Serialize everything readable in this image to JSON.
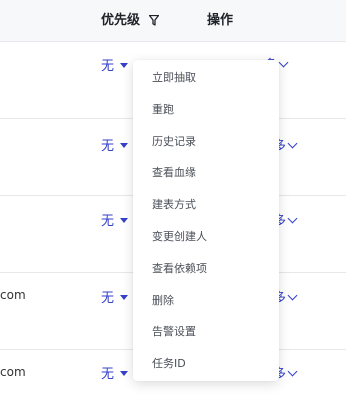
{
  "table": {
    "header": {
      "priority_label": "优先级",
      "action_label": "操作"
    },
    "rows": [
      {
        "priority": "无",
        "email": "",
        "more": "多"
      },
      {
        "priority": "无",
        "email": "",
        "more": "多"
      },
      {
        "priority": "无",
        "email": "",
        "more": "多"
      },
      {
        "priority": "无",
        "email": "com",
        "more": "多"
      },
      {
        "priority": "无",
        "email": "com",
        "more": "多"
      }
    ]
  },
  "dropdown": {
    "items": [
      "立即抽取",
      "重跑",
      "历史记录",
      "查看血缘",
      "建表方式",
      "变更创建人",
      "查看依赖项",
      "删除",
      "告警设置",
      "任务ID"
    ]
  },
  "colors": {
    "accent": "#3440c7",
    "header_bg": "#f7f8fa",
    "border": "#e6e8eb"
  }
}
